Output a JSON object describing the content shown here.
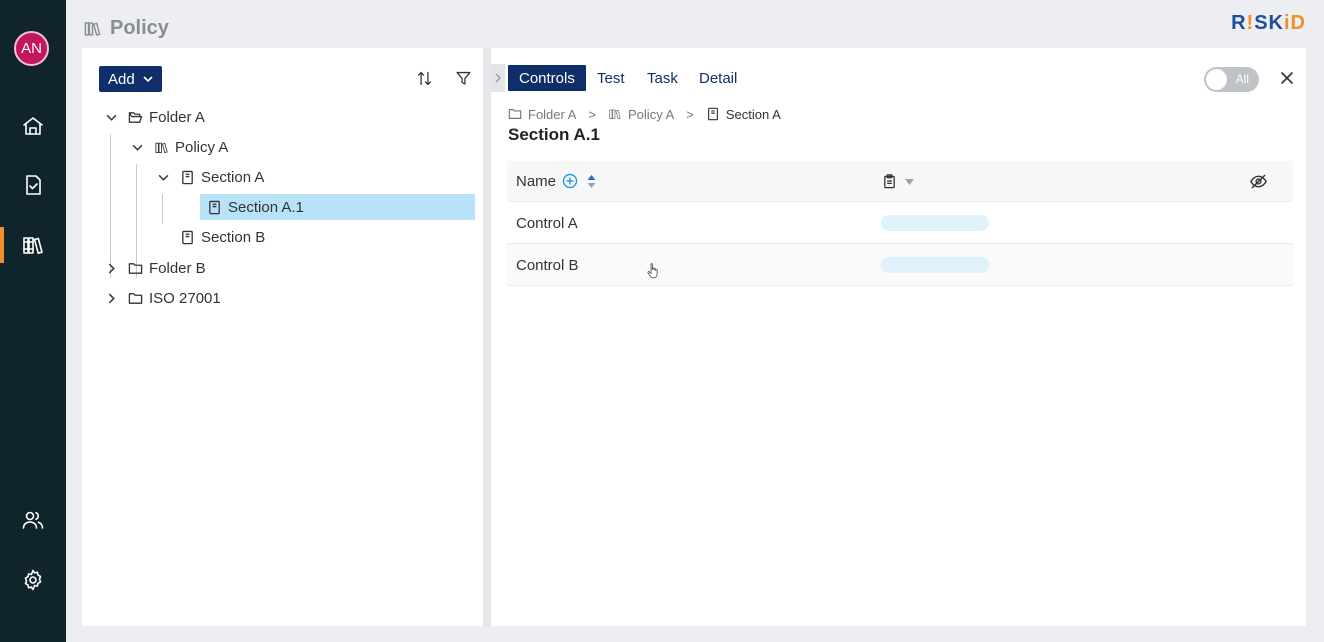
{
  "nav": {
    "avatar_initials": "AN",
    "items": [
      {
        "icon": "home-icon",
        "active": false
      },
      {
        "icon": "task-check-icon",
        "active": false
      },
      {
        "icon": "policy-library-icon",
        "active": true
      },
      {
        "icon": "users-icon",
        "active": false
      },
      {
        "icon": "gear-icon",
        "active": false
      }
    ]
  },
  "header": {
    "title": "Policy",
    "logo_text_a": "R",
    "logo_text_b": "!",
    "logo_text_c": "SK",
    "logo_text_d": "i",
    "logo_text_e": "D"
  },
  "tree": {
    "add_label": "Add",
    "items": [
      {
        "label": "Folder A",
        "type": "folder-open",
        "expanded": true,
        "depth": 0
      },
      {
        "label": "Policy A",
        "type": "policy",
        "expanded": true,
        "depth": 1
      },
      {
        "label": "Section A",
        "type": "section",
        "expanded": true,
        "depth": 2
      },
      {
        "label": "Section A.1",
        "type": "section",
        "selected": true,
        "depth": 3
      },
      {
        "label": "Section B",
        "type": "section",
        "depth": 2
      },
      {
        "label": "Folder B",
        "type": "folder",
        "expanded": false,
        "depth": 0
      },
      {
        "label": "ISO 27001",
        "type": "folder",
        "expanded": false,
        "depth": 0
      }
    ]
  },
  "detail": {
    "tabs": [
      {
        "label": "Controls",
        "active": true
      },
      {
        "label": "Test",
        "active": false
      },
      {
        "label": "Task",
        "active": false
      },
      {
        "label": "Detail",
        "active": false
      }
    ],
    "toggle_label": "All",
    "toggle_on": false,
    "breadcrumb": [
      {
        "label": "Folder A",
        "icon": "folder-icon"
      },
      {
        "label": "Policy A",
        "icon": "policy-library-icon"
      },
      {
        "label": "Section A",
        "icon": "section-icon"
      }
    ],
    "breadcrumb_separator": ">",
    "section_title": "Section A.1",
    "table": {
      "name_header": "Name",
      "rows": [
        {
          "name": "Control A"
        },
        {
          "name": "Control B"
        }
      ]
    }
  },
  "colors": {
    "nav_bg": "#10252b",
    "accent": "#0f2f6b",
    "active_marker": "#f0902a",
    "selected_row": "#b8e2f8"
  }
}
